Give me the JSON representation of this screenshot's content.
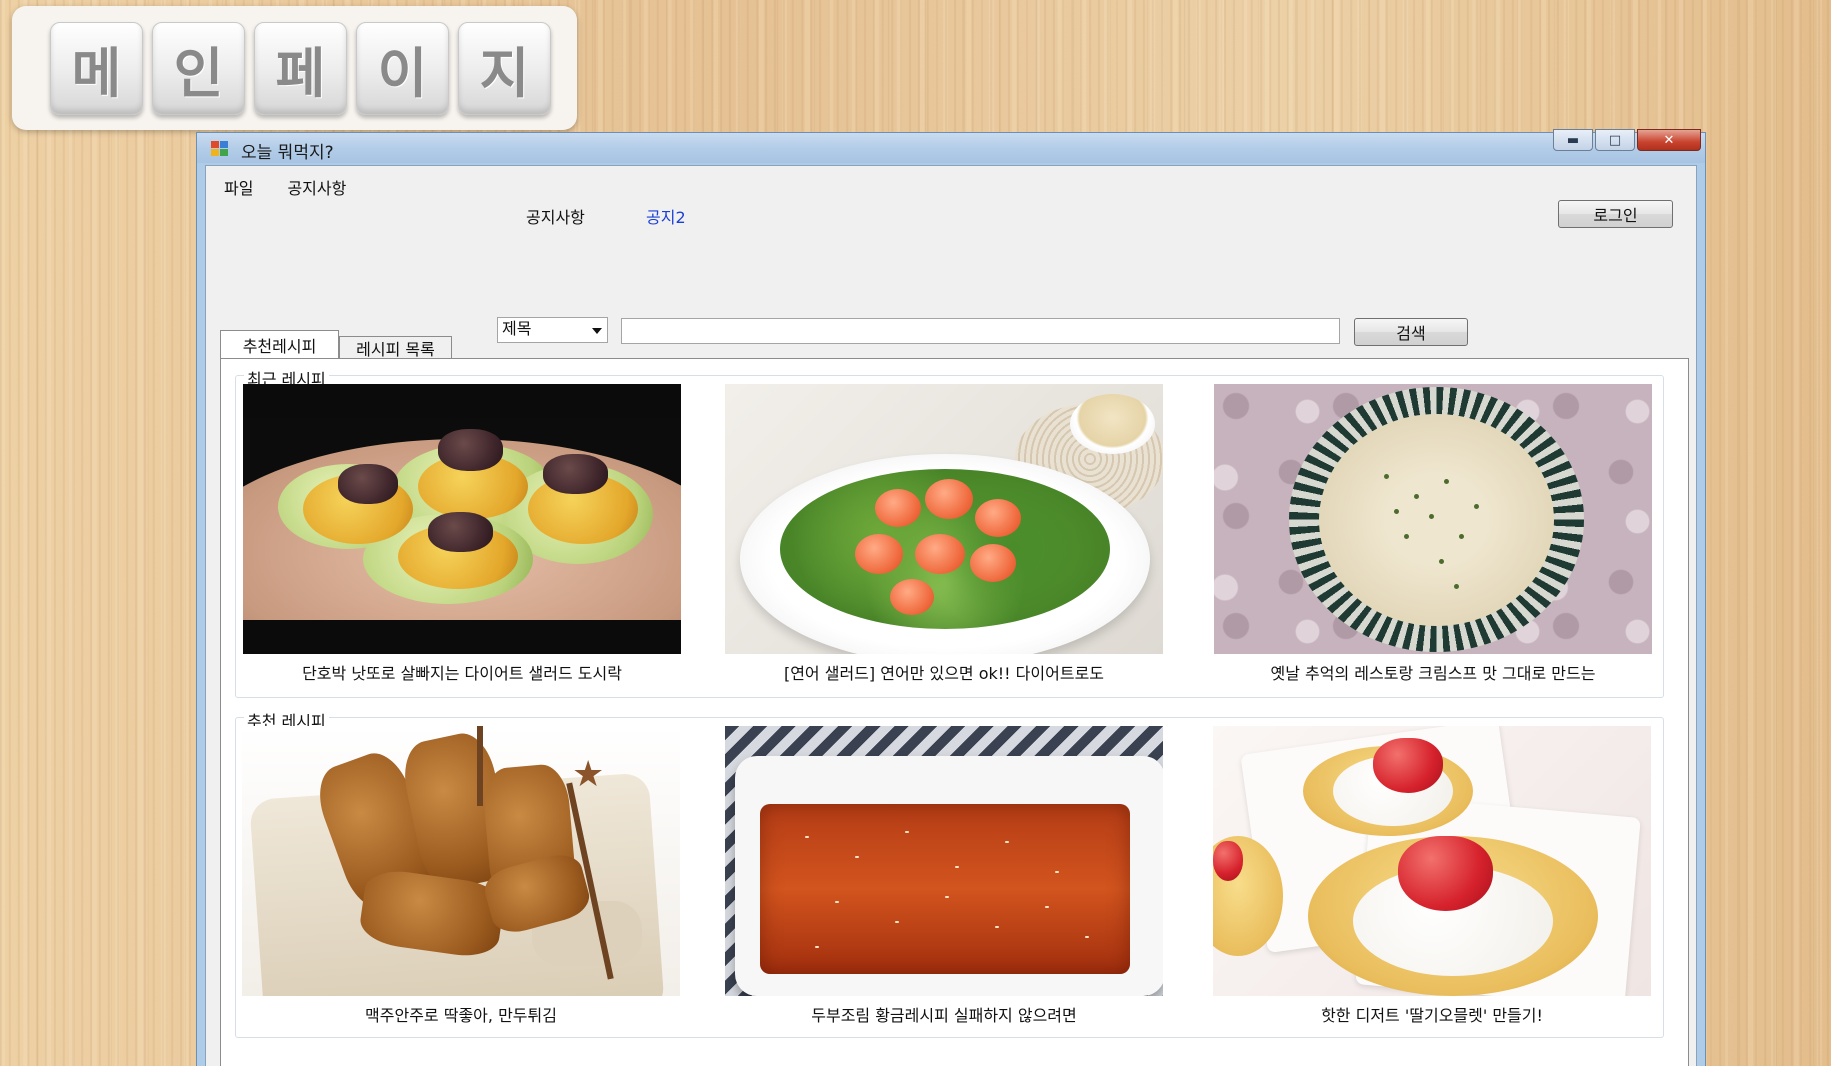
{
  "banner": {
    "letters": [
      "메",
      "인",
      "페",
      "이",
      "지"
    ]
  },
  "window": {
    "title": "오늘 뭐먹지?",
    "icon": "app-icon",
    "controls": {
      "minimize": "minimize-icon",
      "maximize": "maximize-icon",
      "close": "close-icon"
    }
  },
  "menu": {
    "items": [
      "파일",
      "공지사항"
    ]
  },
  "notice": {
    "label": "공지사항",
    "link_text": "공지2"
  },
  "login_button": "로그인",
  "search": {
    "field_select": "제목",
    "query": "",
    "button": "검색"
  },
  "tabs": [
    {
      "label": "추천레시피",
      "active": true
    },
    {
      "label": "레시피 목록",
      "active": false
    }
  ],
  "sections": {
    "recent": {
      "title": "최근 레시피",
      "cards": [
        {
          "caption": "단호박 낫또로 살빠지는 다이어트 샐러드 도시락"
        },
        {
          "caption": "[연어 샐러드] 연어만 있으면 ok!! 다이어트로도"
        },
        {
          "caption": "옛날 추억의 레스토랑 크림스프 맛 그대로 만드는"
        }
      ]
    },
    "recommended": {
      "title": "추천 레시피",
      "cards": [
        {
          "caption": "맥주안주로 딱좋아, 만두튀김"
        },
        {
          "caption": "두부조림 황금레시피 실패하지 않으려면"
        },
        {
          "caption": "핫한 디저트 '딸기오믈렛' 만들기!"
        }
      ]
    }
  },
  "colors": {
    "link": "#1a3fd8",
    "window_frame": "#aecbe8",
    "close_button": "#c8432e"
  }
}
